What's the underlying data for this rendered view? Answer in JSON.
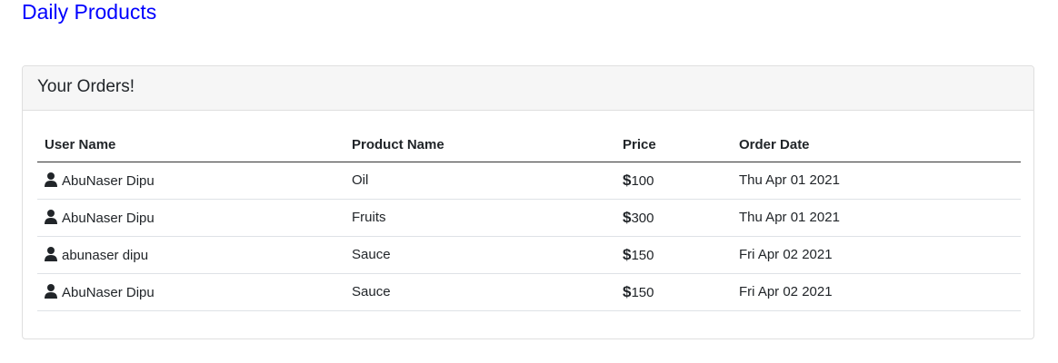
{
  "brand": {
    "title": "Daily Products"
  },
  "card": {
    "header": "Your Orders!",
    "columns": [
      "User Name",
      "Product Name",
      "Price",
      "Order Date"
    ],
    "rows": [
      {
        "user": "AbuNaser Dipu",
        "product": "Oil",
        "currency": "$",
        "price": "100",
        "date": "Thu Apr 01 2021"
      },
      {
        "user": "AbuNaser Dipu",
        "product": "Fruits",
        "currency": "$",
        "price": "300",
        "date": "Thu Apr 01 2021"
      },
      {
        "user": "abunaser dipu",
        "product": "Sauce",
        "currency": "$",
        "price": "150",
        "date": "Fri Apr 02 2021"
      },
      {
        "user": "AbuNaser Dipu",
        "product": "Sauce",
        "currency": "$",
        "price": "150",
        "date": "Fri Apr 02 2021"
      }
    ]
  },
  "icons": {
    "user": "user-icon",
    "currency": "dollar-icon"
  },
  "colors": {
    "brand": "#0000ff",
    "header_bg": "#f6f6f6",
    "border": "#dfdfdf"
  }
}
